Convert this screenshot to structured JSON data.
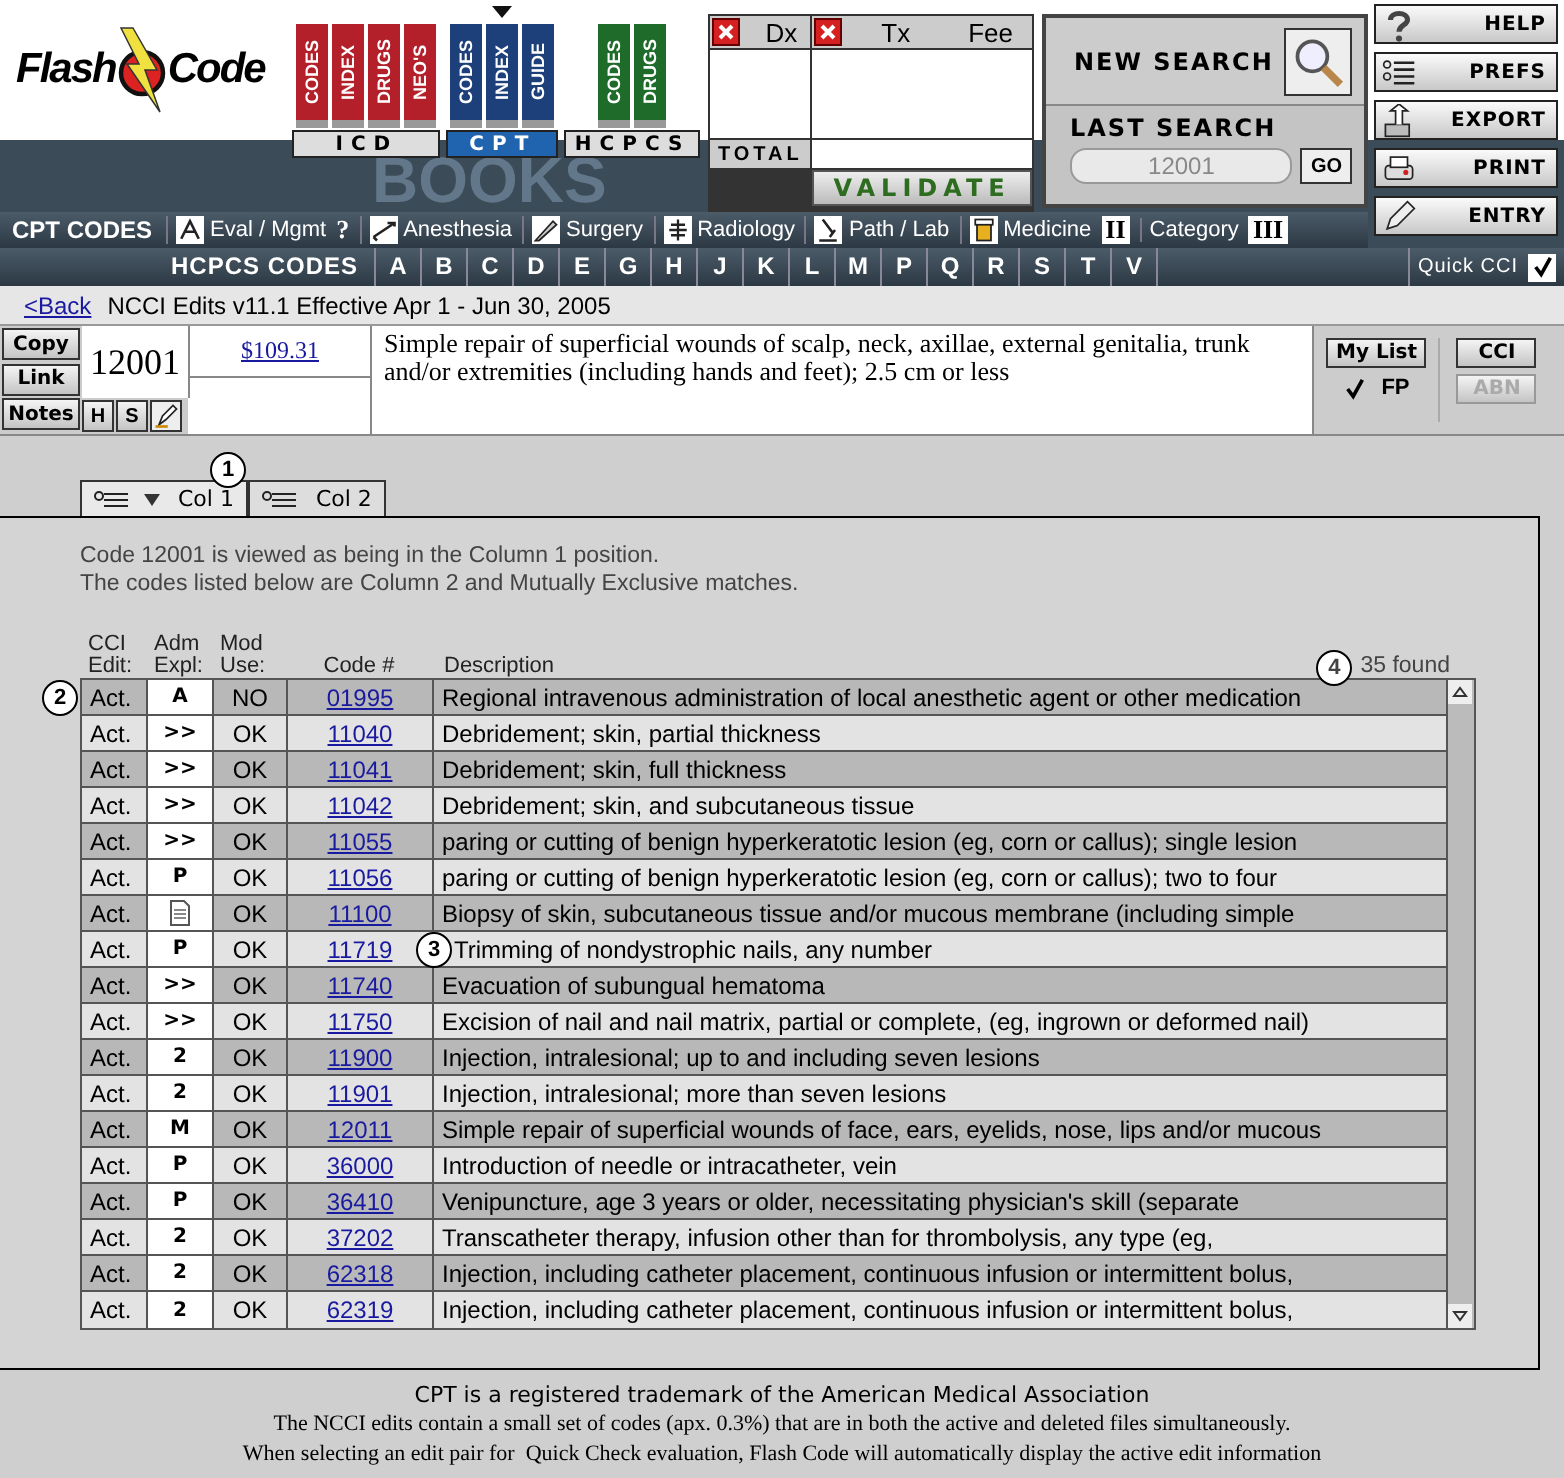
{
  "logo": {
    "first_word": "Flash",
    "second_word": "Code"
  },
  "book_groups": [
    {
      "label": "ICD",
      "selected": false,
      "color": "#b3202a",
      "books": [
        "CODES",
        "INDEX",
        "DRUGS",
        "NEO'S"
      ]
    },
    {
      "label": "CPT",
      "selected": true,
      "color": "#1d3f7a",
      "books": [
        "CODES",
        "INDEX",
        "GUIDE"
      ]
    },
    {
      "label": "HCPCS",
      "selected": false,
      "color": "#1f6b2a",
      "books": [
        "CODES",
        "DRUGS"
      ]
    }
  ],
  "banner_text": "BOOKS",
  "claim_panel": {
    "dx_header": "Dx",
    "tx_header": "Tx",
    "fee_header": "Fee",
    "total_label": "TOTAL",
    "validate_button": "VALIDATE"
  },
  "search": {
    "new_search": "NEW SEARCH",
    "last_search_label": "LAST SEARCH",
    "last_search_value": "12001",
    "go_button": "GO"
  },
  "side_buttons": [
    {
      "kind": "help",
      "label": "HELP"
    },
    {
      "kind": "prefs",
      "label": "PREFS"
    },
    {
      "kind": "export",
      "label": "EXPORT"
    },
    {
      "kind": "print",
      "label": "PRINT"
    },
    {
      "kind": "entry",
      "label": "ENTRY"
    }
  ],
  "cpt_bar": {
    "title": "CPT CODES",
    "items": [
      {
        "kind": "eval",
        "label": "Eval / Mgmt"
      },
      {
        "kind": "glyph",
        "glyph": "?"
      },
      {
        "kind": "anesthesia",
        "label": "Anesthesia"
      },
      {
        "kind": "surgery",
        "label": "Surgery"
      },
      {
        "kind": "radiology",
        "label": "Radiology"
      },
      {
        "kind": "pathlab",
        "label": "Path / Lab"
      },
      {
        "kind": "medicine",
        "label": "Medicine"
      },
      {
        "kind": "glyph",
        "glyph": "II"
      },
      {
        "kind": "text",
        "label": "Category"
      },
      {
        "kind": "glyph",
        "glyph": "III"
      }
    ]
  },
  "hcpcs_bar": {
    "title": "HCPCS CODES",
    "letters": [
      "A",
      "B",
      "C",
      "D",
      "E",
      "G",
      "H",
      "J",
      "K",
      "L",
      "M",
      "P",
      "Q",
      "R",
      "S",
      "T",
      "V"
    ],
    "quick_cci": {
      "label": "Quick CCI",
      "checked": true
    }
  },
  "nav": {
    "back_link": "<Back",
    "title": "NCCI Edits v11.1 Effective Apr 1 - Jun 30, 2005"
  },
  "code_info": {
    "buttons": [
      "Copy",
      "Link",
      "Notes"
    ],
    "small_buttons": [
      "H",
      "S"
    ],
    "code": "12001",
    "fee": "$109.31",
    "description": "Simple repair of superficial wounds of scalp, neck, axillae, external genitalia, trunk and/or extremities (including hands and feet); 2.5 cm or less",
    "my_list_button": "My List",
    "fp": {
      "label": "FP",
      "checked": true
    },
    "cci_button": {
      "label": "CCI",
      "disabled": false
    },
    "abn_button": {
      "label": "ABN",
      "disabled": true
    }
  },
  "column_tabs": [
    {
      "label": "Col 1",
      "selected": true
    },
    {
      "label": "Col 2",
      "selected": false
    }
  ],
  "tabs_callout": "1",
  "results": {
    "intro_lines": [
      "Code 12001 is viewed as being in the Column 1 position.",
      "The codes listed below are Column 2 and Mutually Exclusive matches."
    ],
    "found_callout": "4",
    "found": "35 found",
    "columns": [
      "CCI Edit:",
      "Adm Expl:",
      "Mod Use:",
      "Code #",
      "Description"
    ],
    "rows": [
      {
        "kind": "symbol",
        "cci": "Act.",
        "adm": "A",
        "mod": "NO",
        "code": "01995",
        "description": "Regional intravenous administration of local anesthetic agent or other medication",
        "callout": "2"
      },
      {
        "kind": "symbol",
        "cci": "Act.",
        "adm": ">>",
        "mod": "OK",
        "code": "11040",
        "description": "Debridement; skin, partial thickness"
      },
      {
        "kind": "symbol",
        "cci": "Act.",
        "adm": ">>",
        "mod": "OK",
        "code": "11041",
        "description": "Debridement; skin, full thickness"
      },
      {
        "kind": "symbol",
        "cci": "Act.",
        "adm": ">>",
        "mod": "OK",
        "code": "11042",
        "description": "Debridement; skin, and subcutaneous tissue"
      },
      {
        "kind": "symbol",
        "cci": "Act.",
        "adm": ">>",
        "mod": "OK",
        "code": "11055",
        "description": "paring or cutting of benign hyperkeratotic lesion (eg, corn or callus); single lesion"
      },
      {
        "kind": "symbol",
        "cci": "Act.",
        "adm": "P",
        "mod": "OK",
        "code": "11056",
        "description": "paring or cutting of benign hyperkeratotic lesion (eg, corn or callus); two to four"
      },
      {
        "kind": "document",
        "cci": "Act.",
        "mod": "OK",
        "code": "11100",
        "description": "Biopsy of skin, subcutaneous tissue and/or mucous membrane (including simple"
      },
      {
        "kind": "symbol",
        "cci": "Act.",
        "adm": "P",
        "mod": "OK",
        "code": "11719",
        "description": "Trimming of nondystrophic nails, any number",
        "callout": "3"
      },
      {
        "kind": "symbol",
        "cci": "Act.",
        "adm": ">>",
        "mod": "OK",
        "code": "11740",
        "description": "Evacuation of subungual hematoma"
      },
      {
        "kind": "symbol",
        "cci": "Act.",
        "adm": ">>",
        "mod": "OK",
        "code": "11750",
        "description": "Excision of nail and nail matrix, partial or complete, (eg, ingrown or deformed nail)"
      },
      {
        "kind": "symbol",
        "cci": "Act.",
        "adm": "2",
        "mod": "OK",
        "code": "11900",
        "description": "Injection, intralesional; up to and including seven lesions"
      },
      {
        "kind": "symbol",
        "cci": "Act.",
        "adm": "2",
        "mod": "OK",
        "code": "11901",
        "description": "Injection, intralesional; more than seven lesions"
      },
      {
        "kind": "symbol",
        "cci": "Act.",
        "adm": "M",
        "mod": "OK",
        "code": "12011",
        "description": "Simple repair of superficial wounds of face, ears, eyelids, nose, lips and/or mucous"
      },
      {
        "kind": "symbol",
        "cci": "Act.",
        "adm": "P",
        "mod": "OK",
        "code": "36000",
        "description": "Introduction of needle or intracatheter, vein"
      },
      {
        "kind": "symbol",
        "cci": "Act.",
        "adm": "P",
        "mod": "OK",
        "code": "36410",
        "description": "Venipuncture, age 3 years or older, necessitating physician's skill (separate"
      },
      {
        "kind": "symbol",
        "cci": "Act.",
        "adm": "2",
        "mod": "OK",
        "code": "37202",
        "description": "Transcatheter therapy, infusion other than for thrombolysis, any type (eg,"
      },
      {
        "kind": "symbol",
        "cci": "Act.",
        "adm": "2",
        "mod": "OK",
        "code": "62318",
        "description": "Injection, including catheter placement, continuous infusion or intermittent bolus,"
      },
      {
        "kind": "symbol",
        "cci": "Act.",
        "adm": "2",
        "mod": "OK",
        "code": "62319",
        "description": "Injection, including catheter placement, continuous infusion or intermittent bolus,"
      }
    ]
  },
  "footer": {
    "trademark": "CPT is a registered trademark of the American Medical Association",
    "notes": [
      "The NCCI edits contain a small set of codes (apx. 0.3%) that are in both the active and deleted files simultaneously.",
      "When selecting an edit pair for  Quick Check evaluation, Flash Code will automatically display the active edit information"
    ]
  }
}
